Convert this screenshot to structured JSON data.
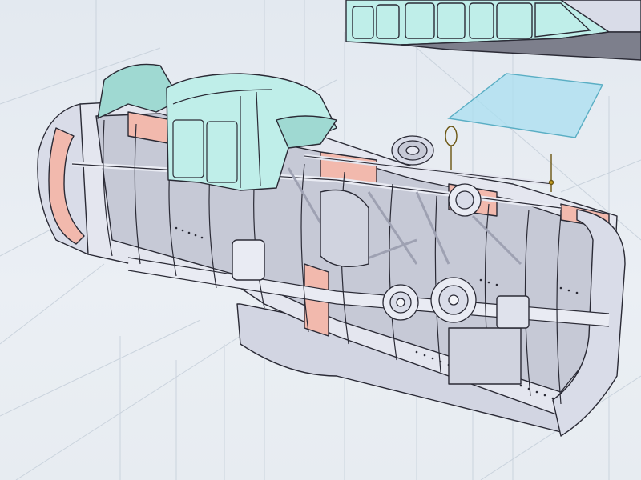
{
  "viewport": {
    "background": "#e6ecf2",
    "grid_color": "#c9d2dc"
  },
  "colors": {
    "skin": "#d9dce8",
    "skin_shadow": "#b9bccb",
    "frame": "#e4e6ef",
    "frame_shadow": "#a9acbb",
    "interior_pink": "#f2b9ad",
    "glass": "#bfeee9",
    "glass_dark": "#9fd9d2",
    "edge": "#2a2a35",
    "panel_selected": "#a9dff0",
    "brass": "#c8a020"
  },
  "model": {
    "parts": [
      "cockpit-canopy-part",
      "canopy-detached-part",
      "glass-panel-part",
      "fuselage-section-part",
      "ammo-drum-part",
      "tail-wheel-part",
      "antenna-mast-part"
    ]
  }
}
